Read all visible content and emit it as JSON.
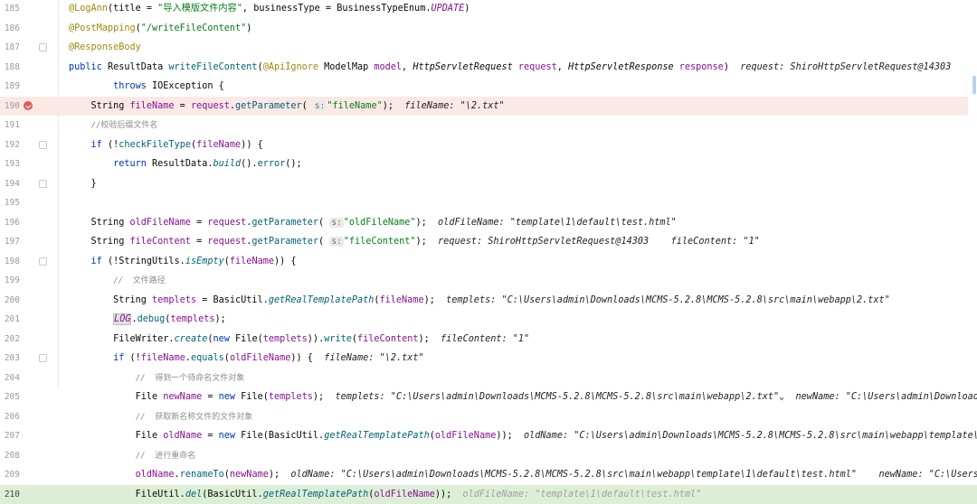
{
  "editor": {
    "lines": [
      {
        "n": "185",
        "bp": false,
        "cur": false,
        "fold": false,
        "parts": [
          [
            "an",
            "@LogAnn"
          ],
          [
            "",
            "(title = "
          ],
          [
            "st",
            "\"导入模版文件内容\""
          ],
          [
            "",
            ", businessType = BusinessTypeEnum."
          ],
          [
            "fd it",
            "UPDATE"
          ],
          [
            "",
            ")"
          ]
        ]
      },
      {
        "n": "186",
        "bp": false,
        "cur": false,
        "fold": false,
        "parts": [
          [
            "an",
            "@PostMapping"
          ],
          [
            "",
            "("
          ],
          [
            "st",
            "\"/writeFileContent\""
          ],
          [
            "",
            ")"
          ]
        ]
      },
      {
        "n": "187",
        "bp": false,
        "cur": false,
        "fold": true,
        "parts": [
          [
            "an",
            "@ResponseBody"
          ]
        ]
      },
      {
        "n": "188",
        "bp": false,
        "cur": false,
        "fold": false,
        "parts": [
          [
            "kw",
            "public "
          ],
          [
            "",
            "ResultData "
          ],
          [
            "mt",
            "writeFileContent"
          ],
          [
            "",
            "("
          ],
          [
            "an",
            "@ApiIgnore "
          ],
          [
            "",
            "ModelMap "
          ],
          [
            "pm",
            "model"
          ],
          [
            "",
            ", "
          ],
          [
            "it",
            "HttpServletRequest "
          ],
          [
            "pm",
            "request"
          ],
          [
            "",
            ", "
          ],
          [
            "it",
            "HttpServletResponse "
          ],
          [
            "pm",
            "response"
          ],
          [
            "",
            ")  "
          ],
          [
            "inl",
            "request: ShiroHttpServletRequest@14303    res"
          ]
        ]
      },
      {
        "n": "189",
        "bp": false,
        "cur": false,
        "fold": false,
        "parts": [
          [
            "",
            "        "
          ],
          [
            "kw",
            "throws "
          ],
          [
            "",
            "IOException {"
          ]
        ]
      },
      {
        "n": "190",
        "bp": true,
        "cur": false,
        "fold": false,
        "parts": [
          [
            "",
            "    String "
          ],
          [
            "pm",
            "fileName"
          ],
          [
            "",
            " = "
          ],
          [
            "pm",
            "request"
          ],
          [
            "",
            "."
          ],
          [
            "mt",
            "getParameter"
          ],
          [
            "",
            "( "
          ],
          [
            "hint",
            "s:"
          ],
          [
            "",
            ""
          ],
          [
            "st",
            "\"fileName\""
          ],
          [
            "",
            ");  "
          ],
          [
            "inl",
            "fileName: \"\\2.txt\""
          ]
        ]
      },
      {
        "n": "191",
        "bp": false,
        "cur": false,
        "fold": false,
        "parts": [
          [
            "",
            "    "
          ],
          [
            "cm",
            "//校验后缀文件名"
          ]
        ]
      },
      {
        "n": "192",
        "bp": false,
        "cur": false,
        "fold": true,
        "parts": [
          [
            "",
            "    "
          ],
          [
            "kw",
            "if "
          ],
          [
            "",
            "(!"
          ],
          [
            "mt",
            "checkFileType"
          ],
          [
            "",
            "("
          ],
          [
            "pm",
            "fileName"
          ],
          [
            "",
            ")) {"
          ]
        ]
      },
      {
        "n": "193",
        "bp": false,
        "cur": false,
        "fold": false,
        "parts": [
          [
            "",
            "        "
          ],
          [
            "kw",
            "return "
          ],
          [
            "",
            "ResultData."
          ],
          [
            "mt it",
            "build"
          ],
          [
            "",
            "()."
          ],
          [
            "mt",
            "error"
          ],
          [
            "",
            "();"
          ]
        ]
      },
      {
        "n": "194",
        "bp": false,
        "cur": false,
        "fold": true,
        "parts": [
          [
            "",
            "    }"
          ]
        ]
      },
      {
        "n": "195",
        "bp": false,
        "cur": false,
        "fold": false,
        "parts": []
      },
      {
        "n": "196",
        "bp": false,
        "cur": false,
        "fold": false,
        "parts": [
          [
            "",
            "    String "
          ],
          [
            "pm",
            "oldFileName"
          ],
          [
            "",
            " = "
          ],
          [
            "pm",
            "request"
          ],
          [
            "",
            "."
          ],
          [
            "mt",
            "getParameter"
          ],
          [
            "",
            "( "
          ],
          [
            "hint",
            "s:"
          ],
          [
            "",
            ""
          ],
          [
            "st",
            "\"oldFileName\""
          ],
          [
            "",
            ");  "
          ],
          [
            "inl",
            "oldFileName: \"template\\1\\default\\test.html\""
          ]
        ]
      },
      {
        "n": "197",
        "bp": false,
        "cur": false,
        "fold": false,
        "parts": [
          [
            "",
            "    String "
          ],
          [
            "pm",
            "fileContent"
          ],
          [
            "",
            " = "
          ],
          [
            "pm",
            "request"
          ],
          [
            "",
            "."
          ],
          [
            "mt",
            "getParameter"
          ],
          [
            "",
            "( "
          ],
          [
            "hint",
            "s:"
          ],
          [
            "",
            ""
          ],
          [
            "st",
            "\"fileContent\""
          ],
          [
            "",
            ");  "
          ],
          [
            "inl",
            "request: ShiroHttpServletRequest@14303    fileContent: \"1\""
          ]
        ]
      },
      {
        "n": "198",
        "bp": false,
        "cur": false,
        "fold": true,
        "parts": [
          [
            "",
            "    "
          ],
          [
            "kw",
            "if "
          ],
          [
            "",
            "(!StringUtils."
          ],
          [
            "mt it",
            "isEmpty"
          ],
          [
            "",
            "("
          ],
          [
            "pm",
            "fileName"
          ],
          [
            "",
            ")) {"
          ]
        ]
      },
      {
        "n": "199",
        "bp": false,
        "cur": false,
        "fold": false,
        "parts": [
          [
            "",
            "        "
          ],
          [
            "cm",
            "//  文件路径"
          ]
        ]
      },
      {
        "n": "200",
        "bp": false,
        "cur": false,
        "fold": false,
        "parts": [
          [
            "",
            "        String "
          ],
          [
            "pm",
            "templets"
          ],
          [
            "",
            " = BasicUtil."
          ],
          [
            "mt it",
            "getRealTemplatePath"
          ],
          [
            "",
            "("
          ],
          [
            "pm",
            "fileName"
          ],
          [
            "",
            ");  "
          ],
          [
            "inl",
            "templets: \"C:\\Users\\admin\\Downloads\\MCMS-5.2.8\\MCMS-5.2.8\\src\\main\\webapp\\2.txt\""
          ]
        ]
      },
      {
        "n": "201",
        "bp": false,
        "cur": false,
        "fold": false,
        "parts": [
          [
            "",
            "        "
          ],
          [
            "fd it logb",
            "LOG"
          ],
          [
            "",
            "."
          ],
          [
            "mt",
            "debug"
          ],
          [
            "",
            "("
          ],
          [
            "pm",
            "templets"
          ],
          [
            "",
            ");"
          ]
        ]
      },
      {
        "n": "202",
        "bp": false,
        "cur": false,
        "fold": false,
        "parts": [
          [
            "",
            "        FileWriter."
          ],
          [
            "mt it",
            "create"
          ],
          [
            "",
            "("
          ],
          [
            "kw",
            "new "
          ],
          [
            "",
            "File("
          ],
          [
            "pm",
            "templets"
          ],
          [
            "",
            "))."
          ],
          [
            "mt",
            "write"
          ],
          [
            "",
            "("
          ],
          [
            "pm",
            "fileContent"
          ],
          [
            "",
            ");  "
          ],
          [
            "inl",
            "fileContent: \"1\""
          ]
        ]
      },
      {
        "n": "203",
        "bp": false,
        "cur": false,
        "fold": true,
        "parts": [
          [
            "",
            "        "
          ],
          [
            "kw",
            "if "
          ],
          [
            "",
            "(!"
          ],
          [
            "pm",
            "fileName"
          ],
          [
            "",
            "."
          ],
          [
            "mt",
            "equals"
          ],
          [
            "",
            "("
          ],
          [
            "pm",
            "oldFileName"
          ],
          [
            "",
            ")) {  "
          ],
          [
            "inl",
            "fileName: \"\\2.txt\""
          ]
        ]
      },
      {
        "n": "204",
        "bp": false,
        "cur": false,
        "fold": false,
        "parts": [
          [
            "",
            "            "
          ],
          [
            "cm",
            "//  得到一个待命名文件对象"
          ]
        ]
      },
      {
        "n": "205",
        "bp": false,
        "cur": false,
        "fold": false,
        "parts": [
          [
            "",
            "            File "
          ],
          [
            "pm",
            "newName"
          ],
          [
            "",
            " = "
          ],
          [
            "kw",
            "new "
          ],
          [
            "",
            "File("
          ],
          [
            "pm",
            "templets"
          ],
          [
            "",
            ");  "
          ],
          [
            "inl",
            "templets: \"C:\\Users\\admin\\Downloads\\MCMS-5.2.8\\MCMS-5.2.8\\src\\main\\webapp\\2.txt\"⌄  newName: \"C:\\Users\\admin\\Downloads"
          ]
        ]
      },
      {
        "n": "206",
        "bp": false,
        "cur": false,
        "fold": false,
        "parts": [
          [
            "",
            "            "
          ],
          [
            "cm",
            "//  获取新名称文件的文件对象"
          ]
        ]
      },
      {
        "n": "207",
        "bp": false,
        "cur": false,
        "fold": false,
        "parts": [
          [
            "",
            "            File "
          ],
          [
            "pm",
            "oldName"
          ],
          [
            "",
            " = "
          ],
          [
            "kw",
            "new "
          ],
          [
            "",
            "File(BasicUtil."
          ],
          [
            "mt it",
            "getRealTemplatePath"
          ],
          [
            "",
            "("
          ],
          [
            "pm",
            "oldFileName"
          ],
          [
            "",
            "));  "
          ],
          [
            "inl",
            "oldName: \"C:\\Users\\admin\\Downloads\\MCMS-5.2.8\\MCMS-5.2.8\\src\\main\\webapp\\template\\1"
          ]
        ]
      },
      {
        "n": "208",
        "bp": false,
        "cur": false,
        "fold": false,
        "parts": [
          [
            "",
            "            "
          ],
          [
            "cm",
            "//  进行重命名"
          ]
        ]
      },
      {
        "n": "209",
        "bp": false,
        "cur": false,
        "fold": false,
        "parts": [
          [
            "",
            "            "
          ],
          [
            "pm",
            "oldName"
          ],
          [
            "",
            "."
          ],
          [
            "mt",
            "renameTo"
          ],
          [
            "",
            "("
          ],
          [
            "pm",
            "newName"
          ],
          [
            "",
            ");  "
          ],
          [
            "inl",
            "oldName: \"C:\\Users\\admin\\Downloads\\MCMS-5.2.8\\MCMS-5.2.8\\src\\main\\webapp\\template\\1\\default\\test.html\"    newName: \"C:\\Users\\a"
          ]
        ]
      },
      {
        "n": "210",
        "bp": false,
        "cur": true,
        "fold": false,
        "parts": [
          [
            "",
            "            FileUtil."
          ],
          [
            "mt it",
            "del"
          ],
          [
            "",
            "(BasicUtil."
          ],
          [
            "mt it",
            "getRealTemplatePath"
          ],
          [
            "",
            "("
          ],
          [
            "pm",
            "oldFileName"
          ],
          [
            "",
            "));  "
          ],
          [
            "inl",
            "oldFileName: \"template\\1\\default\\test.html\""
          ]
        ]
      }
    ]
  }
}
